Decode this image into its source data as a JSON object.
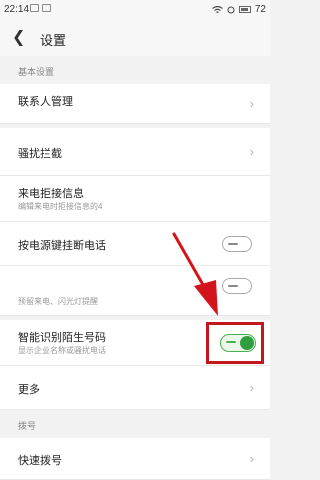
{
  "status": {
    "time": "22:14",
    "battery": "72"
  },
  "header": {
    "title": "设置"
  },
  "sections": [
    {
      "header": "基本设置"
    },
    {
      "header": "拨号"
    }
  ],
  "items": [
    {
      "label": "联系人管理",
      "sub": ""
    },
    {
      "label": "骚扰拦截",
      "sub": ""
    },
    {
      "label": "来电拒接信息",
      "sub": "编辑来电时拒接信息的4"
    },
    {
      "label": "按电源键挂断电话",
      "sub": "",
      "toggle": false
    },
    {
      "label": "",
      "sub": "预留来电、闪光灯提醒",
      "toggle": false
    },
    {
      "label": "智能识别陌生号码",
      "sub": "显示企业名称或骚扰电话",
      "toggle": true
    },
    {
      "label": "更多",
      "sub": ""
    },
    {
      "label": "快速拨号",
      "sub": ""
    }
  ],
  "colors": {
    "accent": "#2e9e3e",
    "highlight": "#c0181e"
  }
}
